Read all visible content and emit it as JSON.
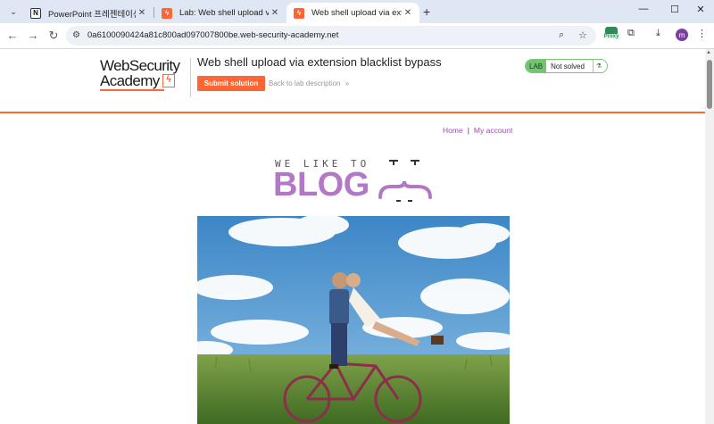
{
  "browser": {
    "tabs": [
      {
        "title": "PowerPoint 프레젠테이션",
        "favicon": "notion-icon",
        "active": false
      },
      {
        "title": "Lab: Web shell upload via exte",
        "favicon": "portswigger-icon",
        "active": false
      },
      {
        "title": "Web shell upload via extensio",
        "favicon": "portswigger-icon",
        "active": true
      }
    ],
    "url": "0a6100090424a81c800ad097007800be.web-security-academy.net",
    "profile_initial": "m",
    "proxy_label": "Proxy"
  },
  "header": {
    "logo_line1": "WebSecurity",
    "logo_line2": "Academy",
    "lab_title": "Web shell upload via extension blacklist bypass",
    "submit_label": "Submit solution",
    "back_label": "Back to lab description",
    "back_arrow": "»",
    "status_badge": "LAB",
    "status_text": "Not solved"
  },
  "nav": {
    "home": "Home",
    "separator": "|",
    "account": "My account"
  },
  "blog": {
    "tagline": "WE LIKE TO",
    "word": "BLOG"
  },
  "colors": {
    "accent": "#ff6633",
    "blog_purple": "#b278c6",
    "link_purple": "#9c4dad",
    "lab_green": "#73c373"
  }
}
